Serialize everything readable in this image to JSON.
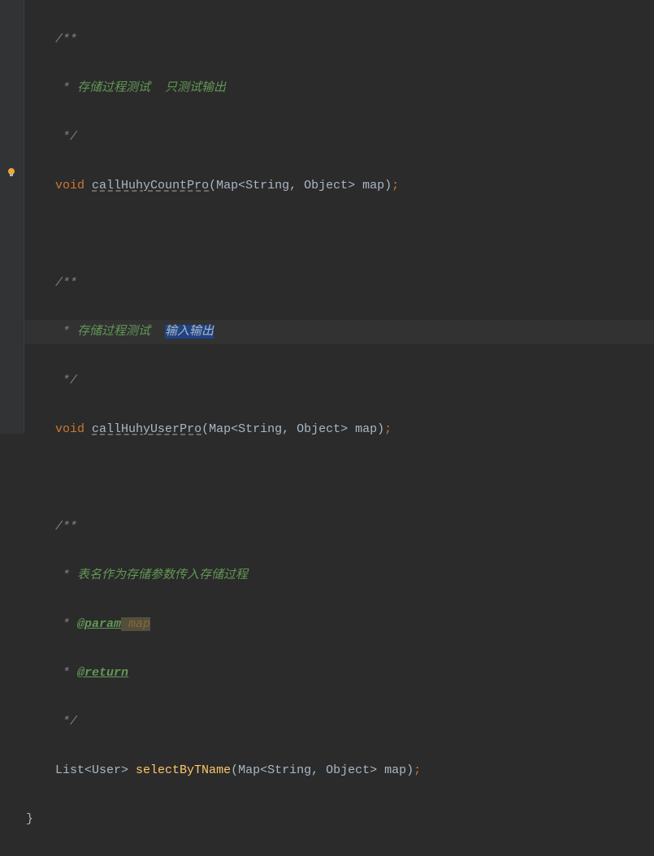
{
  "gutter": {
    "bulb": "💡"
  },
  "code": {
    "line1": "/**",
    "line2_prefix": " * ",
    "line2_text": "存储过程测试  只测试输出",
    "line3": " */",
    "line4_void": "void",
    "line4_method": "callHuhyCountPro",
    "line4_params": "(Map<String, Object> map)",
    "line4_semi": ";",
    "line5": "",
    "line6": "/**",
    "line7_prefix": " * ",
    "line7_text": "存储过程测试  ",
    "line7_sel": "输入输出",
    "line8": " */",
    "line9_void": "void",
    "line9_method": "callHuhyUserPro",
    "line9_params": "(Map<String, Object> map)",
    "line9_semi": ";",
    "line10": "",
    "line11": "/**",
    "line12_prefix": " * ",
    "line12_text": "表名作为存储参数传入存储过程",
    "line13_prefix": " * ",
    "line13_tag": "@param",
    "line13_name": " map",
    "line14_prefix": " * ",
    "line14_tag": "@return",
    "line15": " */",
    "line16_type": "List<User>",
    "line16_method": "selectByTName",
    "line16_params": "(Map<String, Object> map)",
    "line16_semi": ";",
    "line17": "}"
  }
}
